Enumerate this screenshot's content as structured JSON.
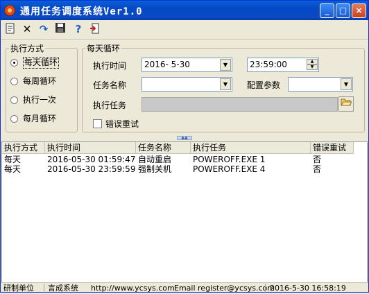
{
  "window": {
    "title": "通用任务调度系统Ver1.0"
  },
  "toolbar": {
    "icons": [
      "new-task-icon",
      "delete-icon",
      "refresh-icon",
      "save-icon",
      "help-icon",
      "exit-icon"
    ]
  },
  "exec_mode": {
    "legend": "执行方式",
    "options": [
      "每天循环",
      "每周循环",
      "执行一次",
      "每月循环"
    ],
    "selected": "每天循环"
  },
  "daily": {
    "legend": "每天循环",
    "exec_time_label": "执行时间",
    "exec_date": "2016- 5-30",
    "exec_clock": "23:59:00",
    "task_name_label": "任务名称",
    "task_name": "",
    "config_label": "配置参数",
    "config_value": "",
    "exec_task_label": "执行任务",
    "exec_task_value": "",
    "retry_label": "错误重试",
    "retry_checked": false
  },
  "table": {
    "columns": [
      "执行方式",
      "执行时间",
      "任务名称",
      "执行任务",
      "错误重试"
    ],
    "rows": [
      [
        "每天",
        "2016-05-30 01:59:47",
        "自动重启",
        "POWEROFF.EXE 1",
        "否"
      ],
      [
        "每天",
        "2016-05-30 23:59:59",
        "强制关机",
        "POWEROFF.EXE 4",
        "否"
      ]
    ]
  },
  "status": {
    "org_label": "研制单位",
    "org_name": "言成系统",
    "url": "http://www.ycsys.com",
    "email": "Email register@ycsys.com",
    "datetime": "2016-5-30 16:58:19"
  }
}
